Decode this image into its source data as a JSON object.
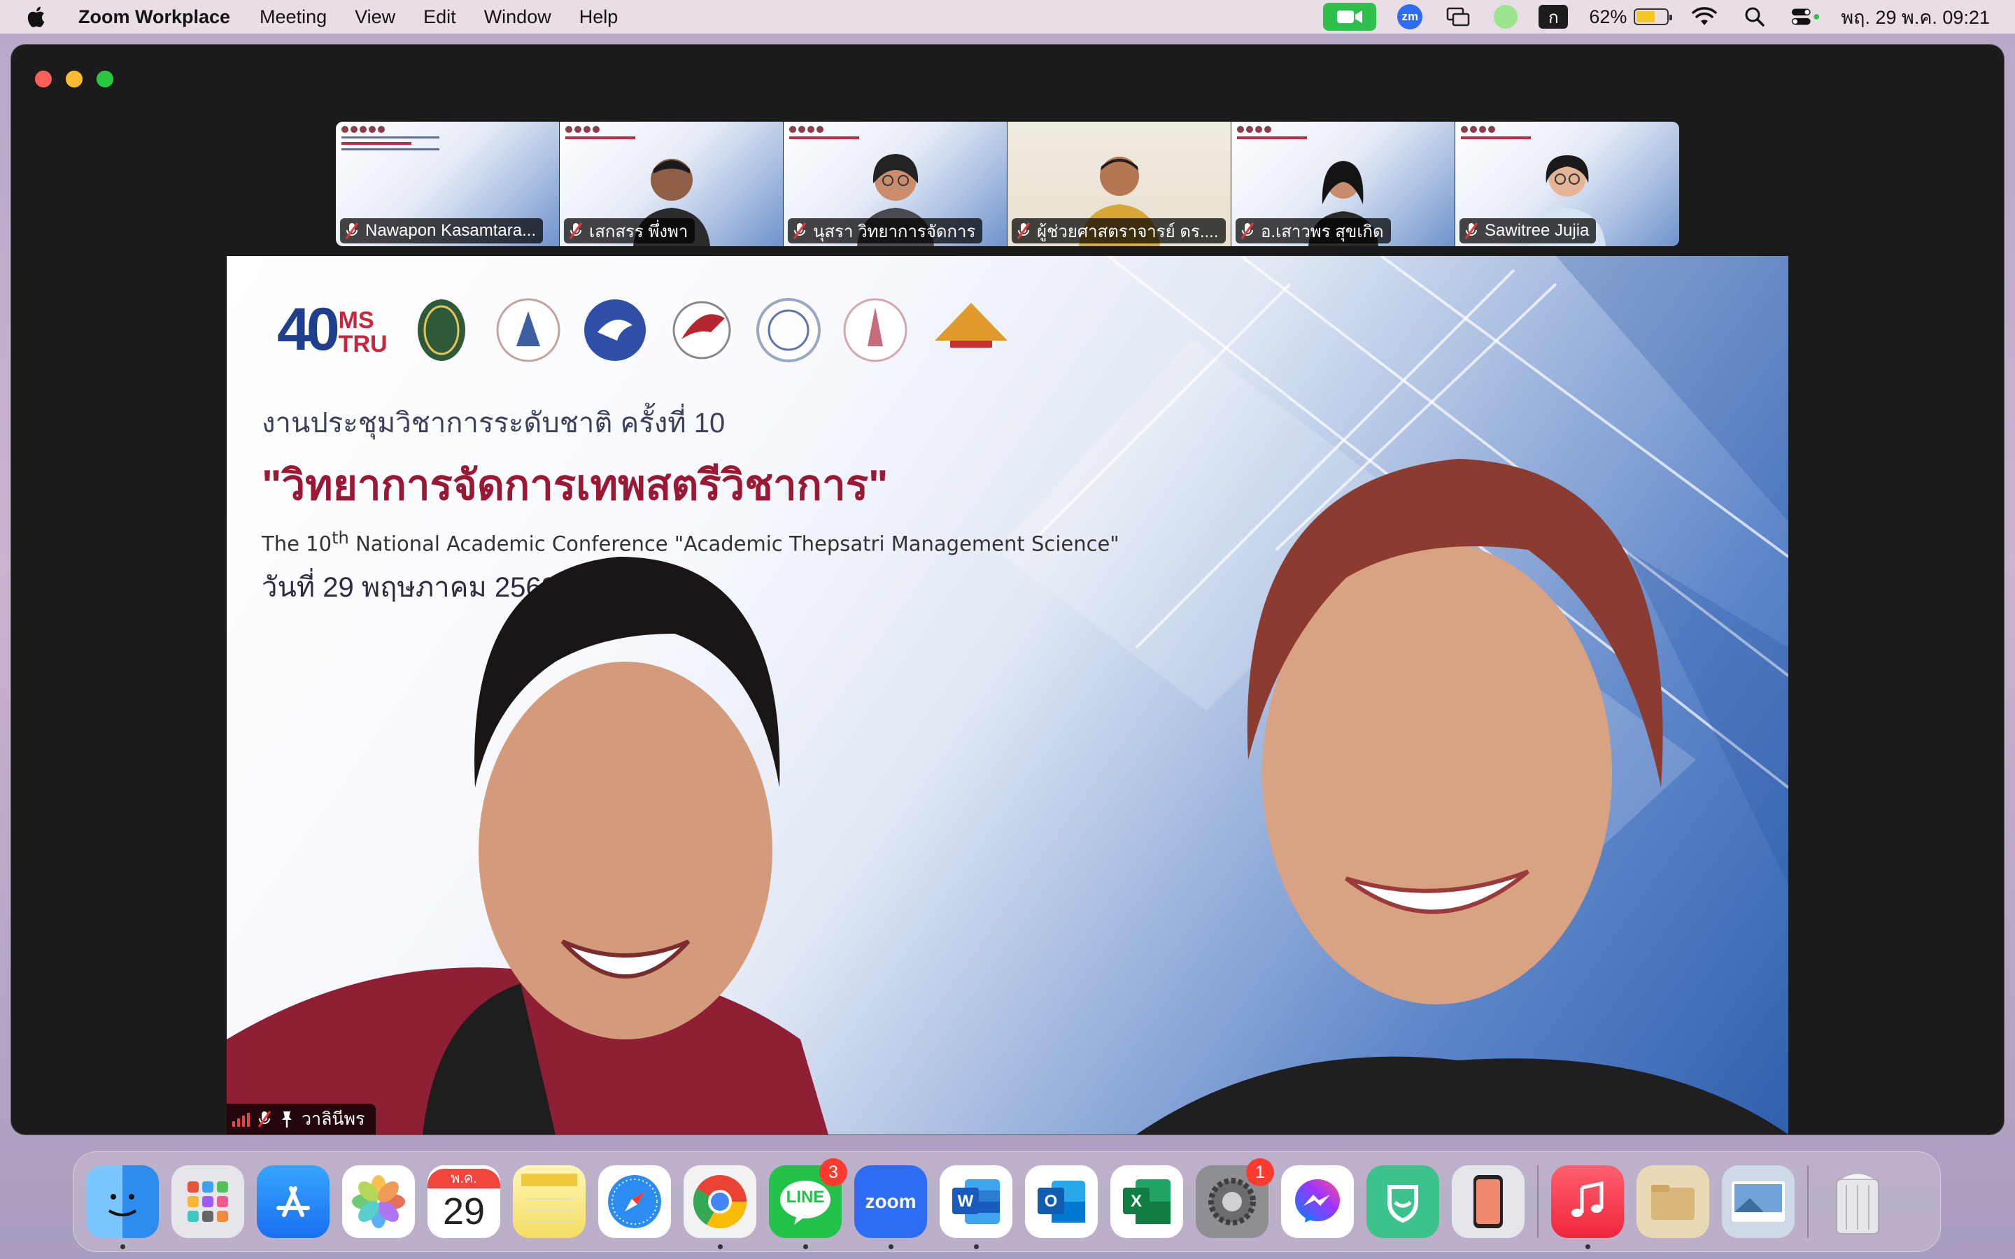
{
  "menubar": {
    "app_name": "Zoom Workplace",
    "menus": [
      "Meeting",
      "View",
      "Edit",
      "Window",
      "Help"
    ],
    "zm_label": "zm",
    "input_source": "ก",
    "battery_percent": "62%",
    "battery_level": 0.62,
    "datetime": "พฤ. 29 พ.ค.  09:21"
  },
  "participants": [
    {
      "name": "Nawapon Kasamtara..."
    },
    {
      "name": "เสกสรร พึ่งพา"
    },
    {
      "name": "นุสรา วิทยาการจัดการ"
    },
    {
      "name": "ผู้ช่วยศาสตราจารย์ ดร...."
    },
    {
      "name": "อ.เสาวพร สุขเกิด"
    },
    {
      "name": "Sawitree Jujia"
    }
  ],
  "main_video": {
    "logo_40": "40",
    "logo_ms": "MS",
    "logo_tru": "TRU",
    "line1": "งานประชุมวิชาการระดับชาติ ครั้งที่ 10",
    "line2": "\"วิทยาการจัดการเทพสตรีวิชาการ\"",
    "line3_pre": "The 10",
    "line3_sup": "th",
    "line3_post": " National Academic Conference \"Academic Thepsatri Management Science\"",
    "line4": "วันที่ 29 พฤษภาคม 2568",
    "speaker_name": "วาลินีพร"
  },
  "dock": {
    "calendar_month": "พ.ค.",
    "calendar_day": "29",
    "line_badge": "3",
    "settings_badge": "1",
    "zoom_label": "zoom",
    "line_label": "LINE"
  },
  "colors": {
    "menubar_bg": "#e9dde6",
    "zoom_green": "#2fbf4d",
    "headline_red": "#9b1834",
    "badge_red": "#ff3b30"
  }
}
